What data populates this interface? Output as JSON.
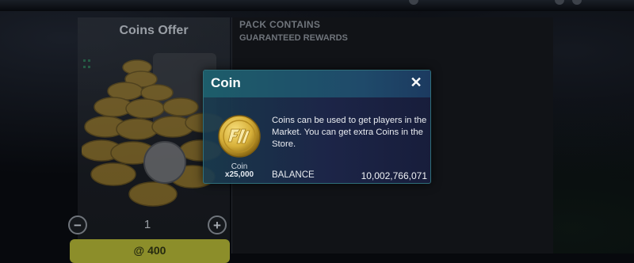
{
  "offer": {
    "title": "Coins Offer",
    "quantity": "1",
    "minus_symbol": "−",
    "plus_symbol": "+",
    "price_label": "@ 400"
  },
  "pack": {
    "contains_label": "PACK CONTAINS",
    "guaranteed_label": "GUARANTEED REWARDS"
  },
  "modal": {
    "title": "Coin",
    "close_symbol": "✕",
    "reward_name": "Coin",
    "reward_quantity": "x25,000",
    "description": "Coins can be used to get players in the Market. You can get extra Coins in the Store.",
    "balance_label": "BALANCE",
    "balance_value": "10,002,766,071"
  },
  "colors": {
    "modal_border": "#2f6f7a",
    "coin_gold": "#d8b13a",
    "buy_button": "#8c8e2a"
  },
  "icons": {
    "reward": "coin-icon",
    "close": "close-icon",
    "decrement": "minus-icon",
    "increment": "plus-icon"
  }
}
